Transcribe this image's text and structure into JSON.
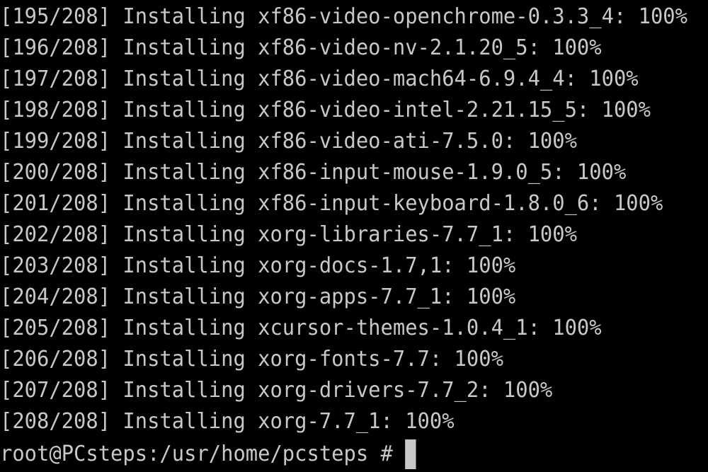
{
  "terminal": {
    "lines": [
      "[195/208] Installing xf86-video-openchrome-0.3.3_4: 100%",
      "[196/208] Installing xf86-video-nv-2.1.20_5: 100%",
      "[197/208] Installing xf86-video-mach64-6.9.4_4: 100%",
      "[198/208] Installing xf86-video-intel-2.21.15_5: 100%",
      "[199/208] Installing xf86-video-ati-7.5.0: 100%",
      "[200/208] Installing xf86-input-mouse-1.9.0_5: 100%",
      "[201/208] Installing xf86-input-keyboard-1.8.0_6: 100%",
      "[202/208] Installing xorg-libraries-7.7_1: 100%",
      "[203/208] Installing xorg-docs-1.7,1: 100%",
      "[204/208] Installing xorg-apps-7.7_1: 100%",
      "[205/208] Installing xcursor-themes-1.0.4_1: 100%",
      "[206/208] Installing xorg-fonts-7.7: 100%",
      "[207/208] Installing xorg-drivers-7.7_2: 100%",
      "[208/208] Installing xorg-7.7_1: 100%"
    ],
    "prompt": "root@PCsteps:/usr/home/pcsteps #",
    "colors": {
      "background": "#000000",
      "foreground": "#c8c8c8"
    }
  }
}
